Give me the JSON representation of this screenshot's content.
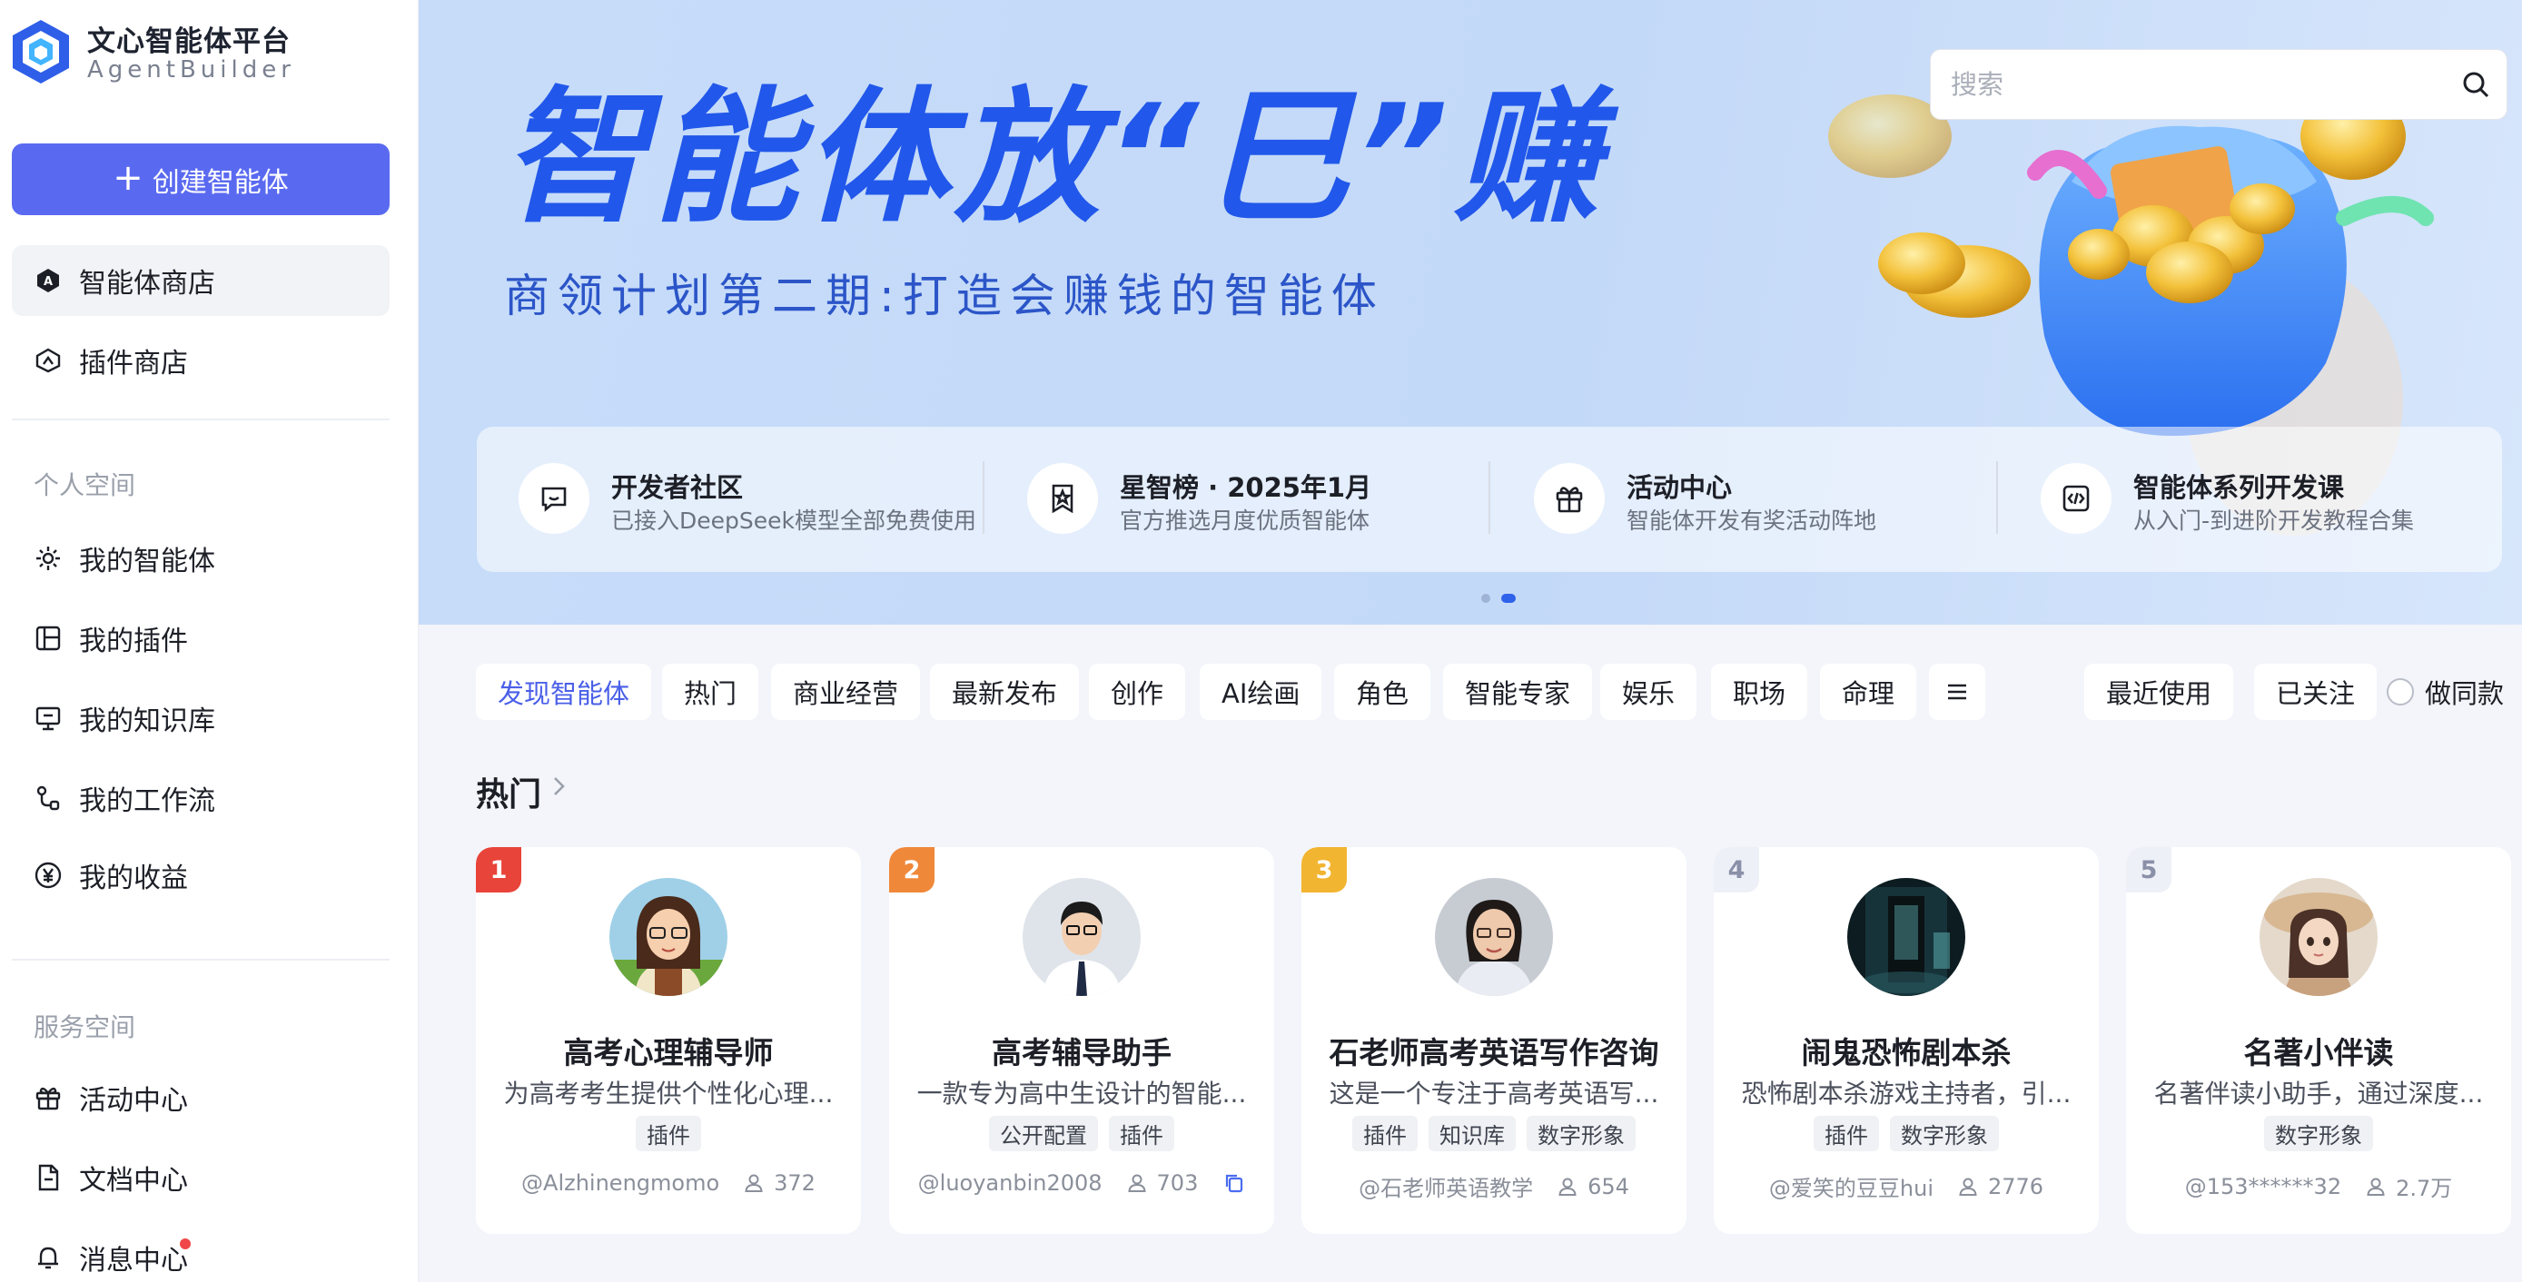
{
  "app": {
    "title": "文心智能体平台",
    "subtitle": "AgentBuilder"
  },
  "sidebar": {
    "create_label": "创建智能体",
    "top_items": [
      {
        "label": "智能体商店",
        "icon": "agent-store-icon"
      },
      {
        "label": "插件商店",
        "icon": "plugin-store-icon"
      }
    ],
    "personal_section": "个人空间",
    "personal_items": [
      {
        "label": "我的智能体",
        "icon": "sparkle-icon"
      },
      {
        "label": "我的插件",
        "icon": "plugin-icon"
      },
      {
        "label": "我的知识库",
        "icon": "monitor-icon"
      },
      {
        "label": "我的工作流",
        "icon": "workflow-icon"
      },
      {
        "label": "我的收益",
        "icon": "yen-icon"
      }
    ],
    "service_section": "服务空间",
    "service_items": [
      {
        "label": "活动中心",
        "icon": "gift-icon"
      },
      {
        "label": "文档中心",
        "icon": "document-icon"
      },
      {
        "label": "消息中心",
        "icon": "bell-icon",
        "has_unread_dot": true
      }
    ]
  },
  "banner": {
    "headline": "智能体放“巳”赚",
    "subhead": "商领计划第二期:打造会赚钱的智能体",
    "search_placeholder": "搜索",
    "quick_links": [
      {
        "title": "开发者社区",
        "desc": "已接入DeepSeek模型全部免费使用",
        "icon": "chat-icon"
      },
      {
        "title": "星智榜 · 2025年1月",
        "desc": "官方推选月度优质智能体",
        "icon": "badge-icon"
      },
      {
        "title": "活动中心",
        "desc": "智能体开发有奖活动阵地",
        "icon": "gift-icon"
      },
      {
        "title": "智能体系列开发课",
        "desc": "从入门-到进阶开发教程合集",
        "icon": "code-icon"
      }
    ],
    "carousel": {
      "count": 2,
      "active_index": 1
    }
  },
  "tabs": {
    "categories": [
      "发现智能体",
      "热门",
      "商业经营",
      "最新发布",
      "创作",
      "AI绘画",
      "角色",
      "智能专家",
      "娱乐",
      "职场",
      "命理"
    ],
    "active": "发现智能体",
    "right": [
      "最近使用",
      "已关注"
    ],
    "radio_label": "做同款"
  },
  "section": {
    "title": "热门"
  },
  "cards": [
    {
      "rank": "1",
      "rank_color": "#e8443a",
      "title": "高考心理辅导师",
      "desc": "为高考考生提供个性化心理...",
      "tags": [
        "插件"
      ],
      "author": "@Alzhinengmomo",
      "users": "372",
      "has_copy": false
    },
    {
      "rank": "2",
      "rank_color": "#f0883a",
      "title": "高考辅导助手",
      "desc": "一款专为高中生设计的智能...",
      "tags": [
        "公开配置",
        "插件"
      ],
      "author": "@luoyanbin2008",
      "users": "703",
      "has_copy": true
    },
    {
      "rank": "3",
      "rank_color": "#f2b531",
      "title": "石老师高考英语写作咨询",
      "desc": "这是一个专注于高考英语写...",
      "tags": [
        "插件",
        "知识库",
        "数字形象"
      ],
      "author": "@石老师英语教学",
      "users": "654",
      "has_copy": false
    },
    {
      "rank": "4",
      "rank_color": "",
      "title": "闹鬼恐怖剧本杀",
      "desc": "恐怖剧本杀游戏主持者，引...",
      "tags": [
        "插件",
        "数字形象"
      ],
      "author": "@爱笑的豆豆hui",
      "users": "2776",
      "has_copy": false
    },
    {
      "rank": "5",
      "rank_color": "",
      "title": "名著小伴读",
      "desc": "名著伴读小助手，通过深度...",
      "tags": [
        "数字形象"
      ],
      "author": "@153******32",
      "users": "2.7万",
      "has_copy": false
    }
  ],
  "colors": {
    "accent": "#5a6af0",
    "headline_blue": "#2157ea",
    "banner_bg": "#c6dcf9",
    "unread_dot": "#f04848"
  }
}
